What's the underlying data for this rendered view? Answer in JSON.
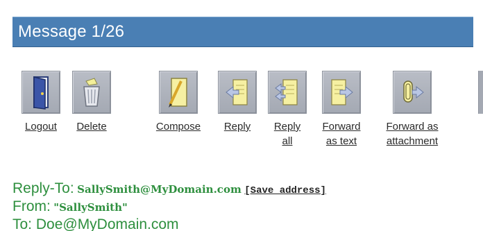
{
  "title": "Message 1/26",
  "toolbar": {
    "items": [
      {
        "label1": "Logout",
        "label2": "",
        "icon": "door-icon"
      },
      {
        "label1": "Delete",
        "label2": "",
        "icon": "trash-icon"
      },
      {
        "label1": "Compose",
        "label2": "",
        "icon": "compose-icon"
      },
      {
        "label1": "Reply",
        "label2": "",
        "icon": "reply-icon"
      },
      {
        "label1": "Reply",
        "label2": "all",
        "icon": "reply-all-icon"
      },
      {
        "label1": "Forward",
        "label2": "as text",
        "icon": "forward-icon"
      },
      {
        "label1": "Forward as",
        "label2": "attachment",
        "icon": "forward-attachment-icon"
      }
    ]
  },
  "headers": {
    "reply_to_label": "Reply-To:",
    "reply_to_value": "SallySmith@MyDomain.com",
    "save_address": "[Save address]",
    "from_label": "From:",
    "from_value": "\"SallySmith\"",
    "to_partial": "To: Doe@MyDomain.com"
  },
  "colors": {
    "title_bar": "#4a7fb4",
    "header_green": "#2e8f3e",
    "icon_bg": "#a4a9b3"
  }
}
